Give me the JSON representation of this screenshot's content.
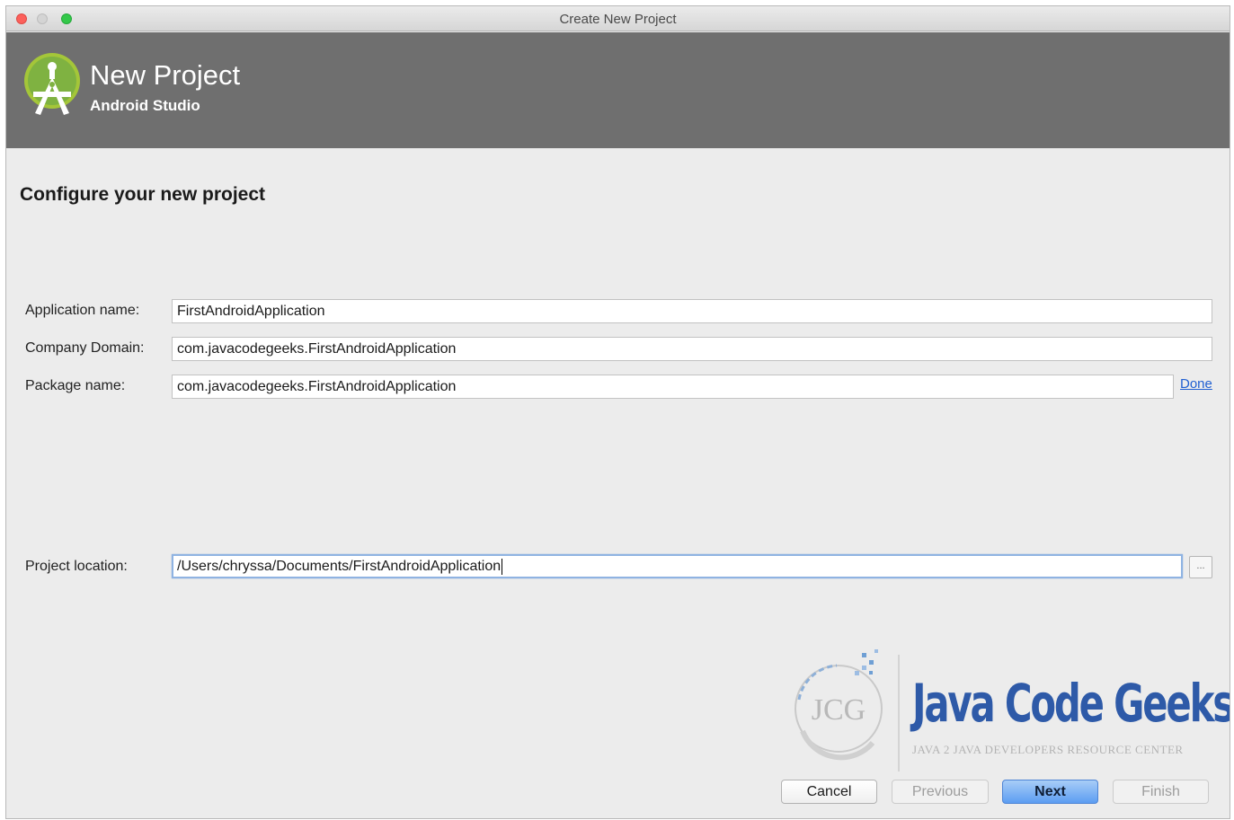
{
  "window": {
    "title": "Create New Project"
  },
  "banner": {
    "title": "New Project",
    "subtitle": "Android Studio",
    "logo_icon": "android-studio-icon",
    "background_color": "#6f6f6f"
  },
  "page": {
    "heading": "Configure your new project"
  },
  "form": {
    "application_name": {
      "label": "Application name:",
      "value": "FirstAndroidApplication"
    },
    "company_domain": {
      "label": "Company Domain:",
      "value": "com.javacodegeeks.FirstAndroidApplication"
    },
    "package_name": {
      "label": "Package name:",
      "value": "com.javacodegeeks.FirstAndroidApplication",
      "link": "Done"
    },
    "project_location": {
      "label": "Project location:",
      "value": "/Users/chryssa/Documents/FirstAndroidApplication",
      "browse_label": "...",
      "browse_icon": "ellipsis-icon"
    }
  },
  "watermark": {
    "badge": "JCG",
    "title": "Java Code Geeks",
    "tagline": "JAVA 2 JAVA DEVELOPERS RESOURCE CENTER"
  },
  "buttons": {
    "cancel": "Cancel",
    "previous": "Previous",
    "next": "Next",
    "finish": "Finish"
  },
  "colors": {
    "accent": "#5c9df2",
    "link": "#1f5fd2",
    "focus": "#8fb3e2"
  }
}
